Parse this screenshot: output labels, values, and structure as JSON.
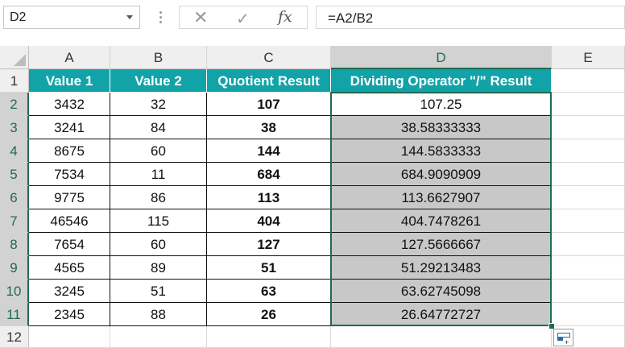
{
  "name_box": "D2",
  "formula": "=A2/B2",
  "columns": [
    "A",
    "B",
    "C",
    "D",
    "E"
  ],
  "rows": [
    "1",
    "2",
    "3",
    "4",
    "5",
    "6",
    "7",
    "8",
    "9",
    "10",
    "11",
    "12"
  ],
  "headers": [
    "Value 1",
    "Value 2",
    "Quotient Result",
    "Dividing Operator \"/\" Result"
  ],
  "data": [
    [
      "3432",
      "32",
      "107",
      "107.25"
    ],
    [
      "3241",
      "84",
      "38",
      "38.58333333"
    ],
    [
      "8675",
      "60",
      "144",
      "144.5833333"
    ],
    [
      "7534",
      "11",
      "684",
      "684.9090909"
    ],
    [
      "9775",
      "86",
      "113",
      "113.6627907"
    ],
    [
      "46546",
      "115",
      "404",
      "404.7478261"
    ],
    [
      "7654",
      "60",
      "127",
      "127.5666667"
    ],
    [
      "4565",
      "89",
      "51",
      "51.29213483"
    ],
    [
      "3245",
      "51",
      "63",
      "63.62745098"
    ],
    [
      "2345",
      "88",
      "26",
      "26.64772727"
    ]
  ],
  "colors": {
    "header_fill": "#12a3a8",
    "selection_border": "#1f6b4f",
    "selected_fill": "#c8c8c8"
  },
  "icons": {
    "cancel": "x-icon",
    "enter": "check-icon",
    "function": "fx-icon"
  }
}
